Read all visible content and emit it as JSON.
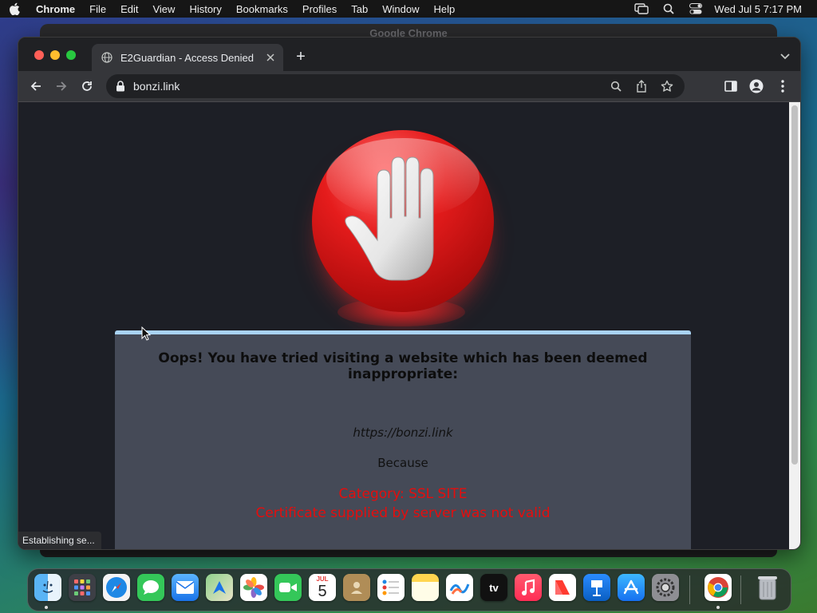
{
  "menubar": {
    "app_name": "Chrome",
    "items": [
      "File",
      "Edit",
      "View",
      "History",
      "Bookmarks",
      "Profiles",
      "Tab",
      "Window",
      "Help"
    ],
    "clock": "Wed Jul 5  7:17 PM",
    "status_icons": [
      "screen-mirroring-icon",
      "spotlight-search-icon",
      "control-center-icon"
    ]
  },
  "background_window": {
    "title": "Google Chrome"
  },
  "browser": {
    "tab": {
      "title": "E2Guardian - Access Denied"
    },
    "new_tab_label": "+",
    "address": {
      "url": "bonzi.link"
    },
    "status_text": "Establishing se..."
  },
  "page": {
    "message": "Oops! You have tried visiting a website which has been deemed inappropriate:",
    "site_url": "https://bonzi.link",
    "because": "Because",
    "category": "Category: SSL SITE",
    "reason": "Certificate supplied by server was not valid",
    "colors": {
      "reason": "#e50d0d",
      "box_background": "#454a57",
      "box_border": "#a9d3f5"
    }
  },
  "dock": {
    "apps": [
      {
        "name": "Finder",
        "icon": "finder-icon"
      },
      {
        "name": "Launchpad",
        "icon": "launchpad-icon"
      },
      {
        "name": "Safari",
        "icon": "safari-icon"
      },
      {
        "name": "Messages",
        "icon": "messages-icon"
      },
      {
        "name": "Mail",
        "icon": "mail-icon"
      },
      {
        "name": "Maps",
        "icon": "maps-icon"
      },
      {
        "name": "Photos",
        "icon": "photos-icon"
      },
      {
        "name": "FaceTime",
        "icon": "facetime-icon"
      },
      {
        "name": "Calendar",
        "icon": "calendar-icon",
        "month": "JUL",
        "day": "5"
      },
      {
        "name": "Contacts",
        "icon": "contacts-icon"
      },
      {
        "name": "Reminders",
        "icon": "reminders-icon"
      },
      {
        "name": "Notes",
        "icon": "notes-icon"
      },
      {
        "name": "Freeform",
        "icon": "freeform-icon"
      },
      {
        "name": "TV",
        "icon": "tv-icon",
        "label": "tv"
      },
      {
        "name": "Music",
        "icon": "music-icon"
      },
      {
        "name": "News",
        "icon": "news-icon"
      },
      {
        "name": "Keynote",
        "icon": "keynote-icon"
      },
      {
        "name": "App Store",
        "icon": "app-store-icon"
      },
      {
        "name": "System Settings",
        "icon": "system-settings-icon"
      },
      {
        "name": "Google Chrome",
        "icon": "chrome-icon"
      },
      {
        "name": "Trash",
        "icon": "trash-icon"
      }
    ]
  }
}
